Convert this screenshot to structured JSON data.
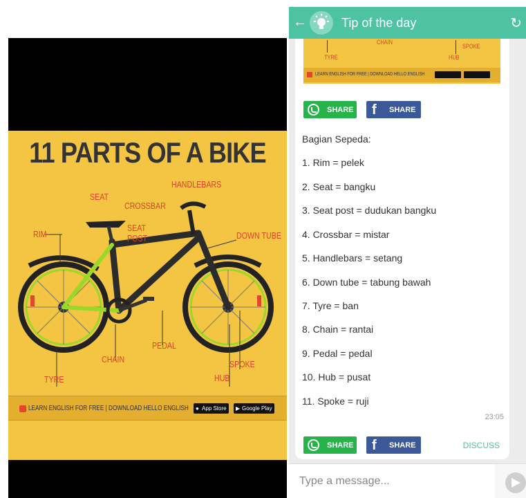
{
  "poster": {
    "title": "11 PARTS OF A BIKE",
    "parts": {
      "seat": "SEAT",
      "handlebars": "HANDLEBARS",
      "crossbar": "CROSSBAR",
      "rim": "RIM",
      "seat_post": "SEAT\nPOST",
      "down_tube": "DOWN TUBE",
      "pedal": "PEDAL",
      "chain": "CHAIN",
      "spoke": "SPOKE",
      "tyre": "TYRE",
      "hub": "HUB"
    },
    "footer_text": "LEARN ENGLISH FOR FREE | DOWNLOAD HELLO ENGLISH",
    "app_store": "App Store",
    "google_play": "Google Play",
    "colors": {
      "background": "#f4c542",
      "label": "#d9452b"
    }
  },
  "appbar": {
    "title": "Tip of the day",
    "back_icon": "arrow-left-icon",
    "refresh_icon": "refresh-icon",
    "color": "#4dc3a3"
  },
  "card": {
    "thumb_labels": {
      "tyre": "TYRE",
      "spoke": "SPOKE",
      "hub": "HUB",
      "chain": "CHAIN"
    },
    "thumb_footer": "LEARN ENGLISH FOR FREE | DOWNLOAD HELLO ENGLISH",
    "share_whatsapp": "SHARE",
    "share_facebook": "SHARE",
    "fb_glyph": "f",
    "heading": "Bagian Sepeda:",
    "items": [
      "1. Rim = pelek",
      "2. Seat = bangku",
      "3. Seat post = dudukan bangku",
      "4. Crossbar = mistar",
      "5. Handlebars = setang",
      "6. Down tube = tabung bawah",
      "7. Tyre = ban",
      "8. Chain = rantai",
      "9. Pedal = pedal",
      "10. Hub = pusat",
      "11. Spoke = ruji"
    ],
    "time": "23:05",
    "discuss": "DISCUSS"
  },
  "compose": {
    "placeholder": "Type a message..."
  }
}
